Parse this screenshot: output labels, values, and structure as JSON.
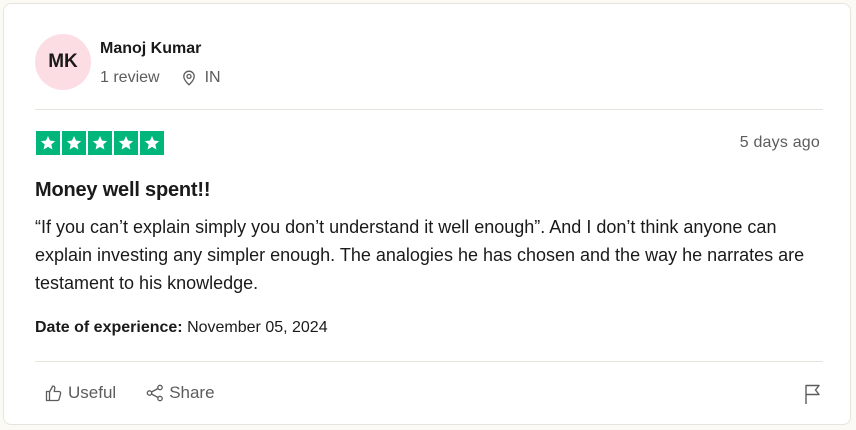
{
  "reviewer": {
    "initials": "MK",
    "name": "Manoj Kumar",
    "review_count": "1 review",
    "country": "IN"
  },
  "rating": {
    "stars": 5,
    "max": 5,
    "color": "#00b67a"
  },
  "review": {
    "date_ago": "5 days ago",
    "title": "Money well spent!!",
    "body": "“If you can’t explain simply you don’t understand it well enough”. And I don’t think anyone can explain investing any simpler enough. The analogies he has chosen and the way he narrates are testament to his knowledge.",
    "experience_label": "Date of experience:",
    "experience_date": "November 05, 2024"
  },
  "actions": {
    "useful_label": "Useful",
    "share_label": "Share"
  },
  "colors": {
    "avatar_bg": "#fcdde4",
    "muted_text": "#5c5c5c"
  },
  "icons": {
    "location": "location-pin-icon",
    "useful": "thumbs-up-icon",
    "share": "share-icon",
    "report": "flag-icon"
  }
}
